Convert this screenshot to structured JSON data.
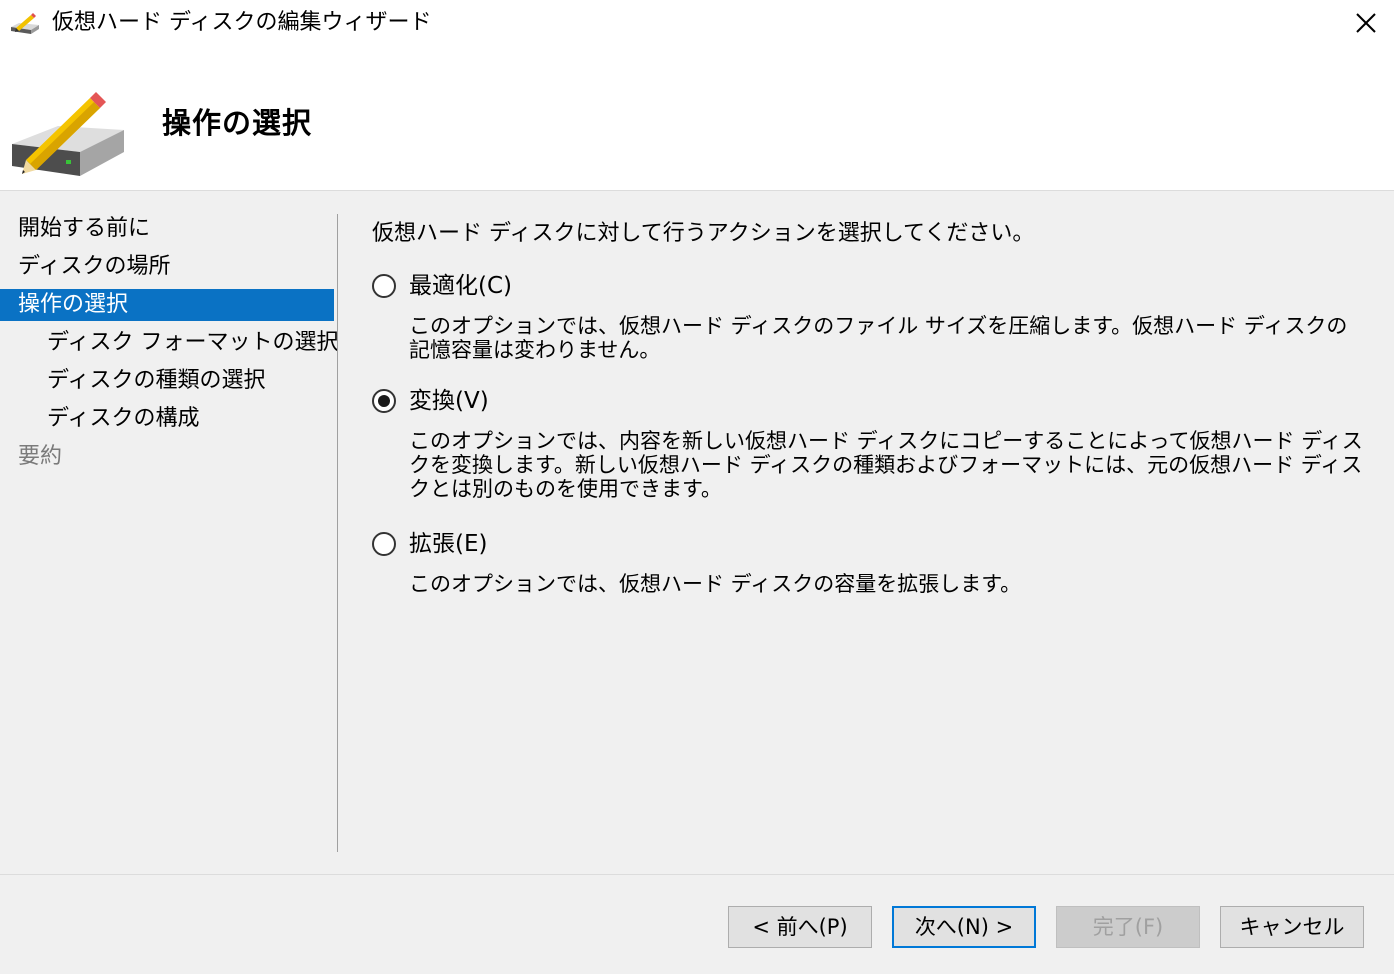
{
  "window": {
    "title": "仮想ハード ディスクの編集ウィザード",
    "close_icon": "close-icon"
  },
  "header": {
    "title": "操作の選択",
    "icon": "disk-pencil-icon"
  },
  "nav": {
    "items": [
      {
        "label": "開始する前に",
        "level": 0,
        "state": "normal"
      },
      {
        "label": "ディスクの場所",
        "level": 0,
        "state": "normal"
      },
      {
        "label": "操作の選択",
        "level": 0,
        "state": "selected"
      },
      {
        "label": "ディスク フォーマットの選択",
        "level": 1,
        "state": "normal"
      },
      {
        "label": "ディスクの種類の選択",
        "level": 1,
        "state": "normal"
      },
      {
        "label": "ディスクの構成",
        "level": 1,
        "state": "normal"
      },
      {
        "label": "要約",
        "level": 0,
        "state": "disabled"
      }
    ]
  },
  "content": {
    "intro": "仮想ハード ディスクに対して行うアクションを選択してください。",
    "options": [
      {
        "label": "最適化(C)",
        "checked": false,
        "description": "このオプションでは、仮想ハード ディスクのファイル サイズを圧縮します。仮想ハード ディスクの記憶容量は変わりません。"
      },
      {
        "label": "変換(V)",
        "checked": true,
        "description": "このオプションでは、内容を新しい仮想ハード ディスクにコピーすることによって仮想ハード ディスクを変換します。新しい仮想ハード ディスクの種類およびフォーマットには、元の仮想ハード ディスクとは別のものを使用できます。"
      },
      {
        "label": "拡張(E)",
        "checked": false,
        "description": "このオプションでは、仮想ハード ディスクの容量を拡張します。"
      }
    ]
  },
  "footer": {
    "prev_label": "< 前へ(P)",
    "next_label": "次へ(N) >",
    "finish_label": "完了(F)",
    "cancel_label": "キャンセル"
  },
  "colors": {
    "selection": "#0a72c4",
    "default_button_border": "#0078d7"
  }
}
